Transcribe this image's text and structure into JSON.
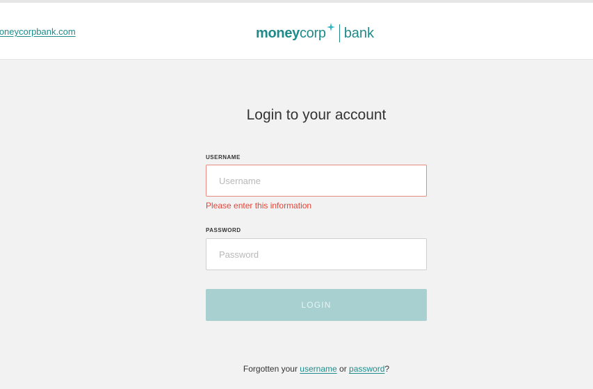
{
  "header": {
    "site_link": "moneycorpbank.com",
    "logo": {
      "money": "money",
      "corp": "corp",
      "bank": "bank",
      "brand_color": "#1f8a8a"
    }
  },
  "main": {
    "title": "Login to your account",
    "username": {
      "label": "USERNAME",
      "placeholder": "Username",
      "value": "",
      "error": "Please enter this information"
    },
    "password": {
      "label": "PASSWORD",
      "placeholder": "Password",
      "value": ""
    },
    "login_button": "LOGIN",
    "forgot": {
      "prefix": "Forgotten your",
      "username_link": "username",
      "middle": "or",
      "password_link": "password",
      "suffix": "?"
    }
  },
  "colors": {
    "error": "#e0453a",
    "button_disabled": "#a8d0d0"
  }
}
